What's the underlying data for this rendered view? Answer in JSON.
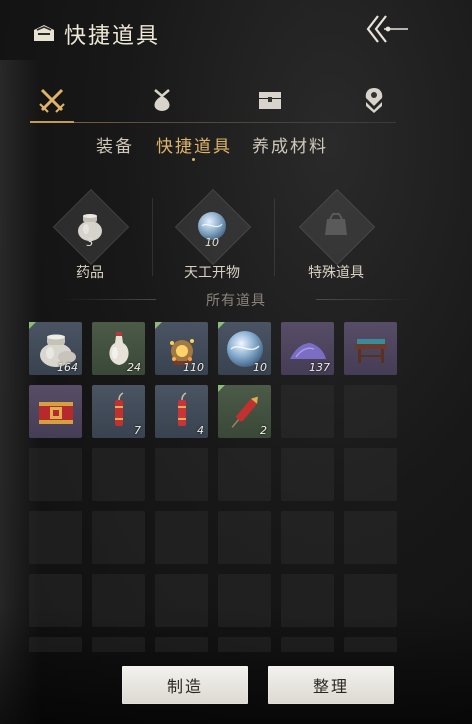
{
  "header": {
    "title": "快捷道具"
  },
  "categories": [
    {
      "name": "crossed-swords-icon",
      "active": true
    },
    {
      "name": "pouch-icon",
      "active": false
    },
    {
      "name": "chest-icon",
      "active": false
    },
    {
      "name": "map-pin-icon",
      "active": false
    }
  ],
  "subtabs": [
    {
      "label": "装备",
      "active": false
    },
    {
      "label": "快捷道具",
      "active": true
    },
    {
      "label": "养成材料",
      "active": false
    }
  ],
  "featured": [
    {
      "label": "药品",
      "count": "3",
      "icon": "jar-icon"
    },
    {
      "label": "天工开物",
      "count": "10",
      "icon": "crystal-orb-icon"
    },
    {
      "label": "特殊道具",
      "count": "",
      "icon": "special-item-icon"
    }
  ],
  "section_title": "所有道具",
  "items": [
    {
      "icon": "jar-icon",
      "count": "164",
      "quality": "blue",
      "corner": true
    },
    {
      "icon": "vase-icon",
      "count": "24",
      "quality": "green",
      "corner": false
    },
    {
      "icon": "fireworks-icon",
      "count": "110",
      "quality": "blue",
      "corner": true
    },
    {
      "icon": "crystal-orb-icon",
      "count": "10",
      "quality": "blue",
      "corner": true
    },
    {
      "icon": "powder-pile-icon",
      "count": "137",
      "quality": "purple",
      "corner": false
    },
    {
      "icon": "table-icon",
      "count": "",
      "quality": "purple",
      "corner": false
    },
    {
      "icon": "lucky-box-icon",
      "count": "",
      "quality": "purple",
      "corner": false
    },
    {
      "icon": "firecracker-icon",
      "count": "7",
      "quality": "blue",
      "corner": false
    },
    {
      "icon": "firecracker-icon",
      "count": "4",
      "quality": "blue",
      "corner": false
    },
    {
      "icon": "rocket-firework-icon",
      "count": "2",
      "quality": "green",
      "corner": true
    }
  ],
  "buttons": {
    "craft": "制造",
    "sort": "整理"
  },
  "colors": {
    "accent": "#e0b36a",
    "quality_blue": "#4a5462",
    "quality_green": "#4c5a48",
    "quality_purple": "#574d66"
  }
}
